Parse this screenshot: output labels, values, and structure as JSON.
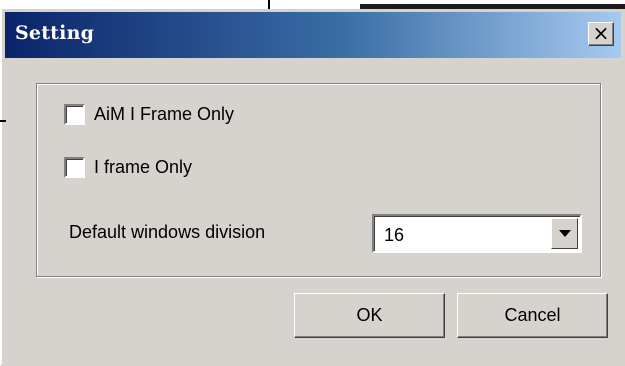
{
  "dialog": {
    "title": "Setting",
    "close_glyph": "×",
    "close_icon": "close-icon"
  },
  "options": {
    "aim_i_frame_only": {
      "label": "AiM I Frame Only",
      "checked": false
    },
    "i_frame_only": {
      "label": "I frame Only",
      "checked": false
    }
  },
  "division": {
    "label": "Default windows division",
    "selected_value": "16",
    "arrow_icon": "chevron-down-icon"
  },
  "buttons": {
    "ok_label": "OK",
    "cancel_label": "Cancel"
  },
  "colors": {
    "face": "#d6d3ce",
    "title_gradient_start": "#0a246a",
    "title_gradient_end": "#a6caf0"
  }
}
